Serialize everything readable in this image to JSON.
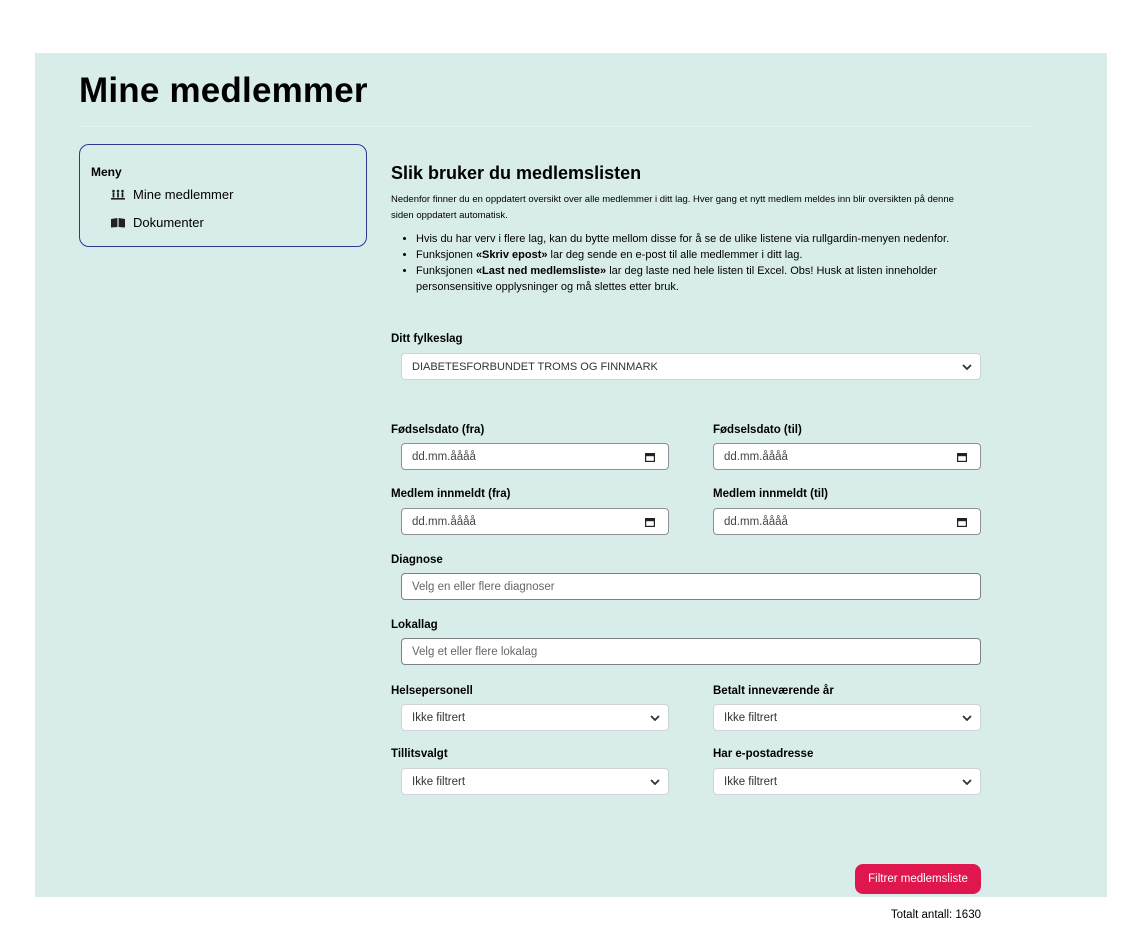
{
  "page": {
    "title": "Mine medlemmer"
  },
  "sidebar": {
    "heading": "Meny",
    "items": [
      {
        "label": "Mine medlemmer",
        "icon": "members-icon"
      },
      {
        "label": "Dokumenter",
        "icon": "books-icon"
      }
    ]
  },
  "main": {
    "title": "Slik bruker du medlemslisten",
    "intro": "Nedenfor finner du en oppdatert oversikt over alle medlemmer i ditt lag. Hver gang et nytt medlem meldes inn blir oversikten på denne siden oppdatert automatisk.",
    "bullets": [
      {
        "text": "Hvis du har verv i flere lag, kan du bytte mellom disse for å se de ulike listene via rullgardin-menyen nedenfor."
      },
      {
        "pre": "Funksjonen ",
        "bold": "«Skriv epost»",
        "post": " lar deg sende en e-post til alle medlemmer i ditt lag."
      },
      {
        "pre": "Funksjonen ",
        "bold": "«Last ned medlemsliste»",
        "post": " lar deg laste ned hele listen til Excel. Obs! Husk at listen inneholder personsensitive opplysninger og må slettes etter bruk."
      }
    ]
  },
  "filters": {
    "fylkeslag": {
      "label": "Ditt fylkeslag",
      "value": "DIABETESFORBUNDET TROMS OG FINNMARK"
    },
    "birth_from": {
      "label": "Fødselsdato (fra)",
      "placeholder": "dd.mm.åååå"
    },
    "birth_to": {
      "label": "Fødselsdato (til)",
      "placeholder": "dd.mm.åååå"
    },
    "joined_from": {
      "label": "Medlem innmeldt (fra)",
      "placeholder": "dd.mm.åååå"
    },
    "joined_to": {
      "label": "Medlem innmeldt (til)",
      "placeholder": "dd.mm.åååå"
    },
    "diagnose": {
      "label": "Diagnose",
      "placeholder": "Velg en eller flere diagnoser"
    },
    "lokallag": {
      "label": "Lokallag",
      "placeholder": "Velg et eller flere lokalag"
    },
    "helsepersonell": {
      "label": "Helsepersonell",
      "value": "Ikke filtrert"
    },
    "betalt": {
      "label": "Betalt inneværende år",
      "value": "Ikke filtrert"
    },
    "tillitsvalgt": {
      "label": "Tillitsvalgt",
      "value": "Ikke filtrert"
    },
    "epost": {
      "label": "Har e-postadresse",
      "value": "Ikke filtrert"
    }
  },
  "actions": {
    "filter_button": "Filtrer medlemsliste"
  },
  "summary": {
    "total": "Totalt antall: 1630"
  },
  "colors": {
    "panel": "#d8ecea",
    "accent": "#e0174f",
    "sidebar_border": "#2b3a8c"
  }
}
